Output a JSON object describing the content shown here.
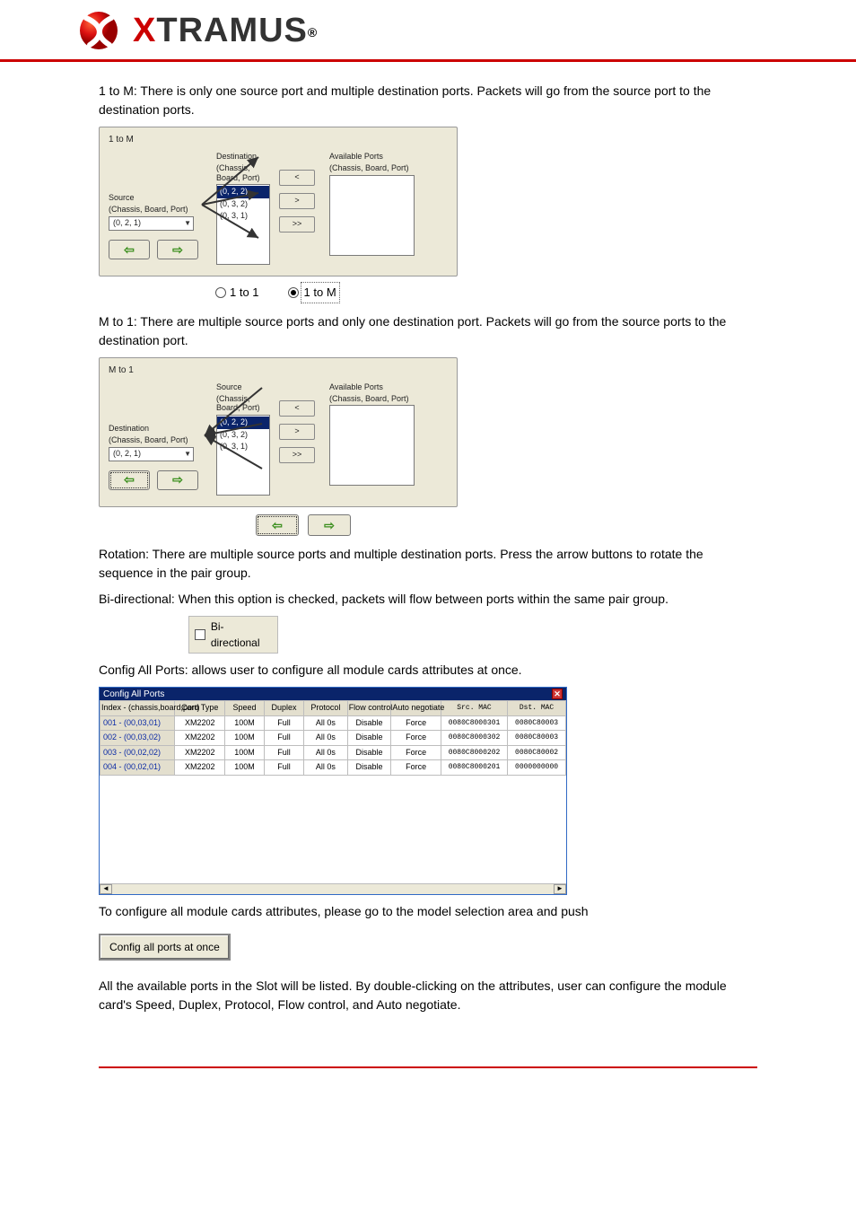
{
  "brand": {
    "x": "X",
    "rest": "TRAMUS",
    "tail": "®"
  },
  "intro_1toM": "1 to M: There is only one source port and multiple destination ports. Packets will go from the source port to the destination ports.",
  "panel_1toM": {
    "title": "1 to M",
    "left_label_top": "Source",
    "left_label_bottom": "(Chassis, Board, Port)",
    "combo_value": "(0, 2, 1)",
    "mid_label_top": "Destination",
    "mid_label_bottom": "(Chassis, Board, Port)",
    "list_items": [
      "(0, 2, 2)",
      "(0, 3, 2)",
      "(0, 3, 1)"
    ],
    "right_label_top": "Available Ports",
    "right_label_bottom": "(Chassis, Board, Port)",
    "btns": {
      "lt": "<",
      "gt": ">",
      "gtgt": ">>"
    }
  },
  "radio_strip": {
    "opt1": "1 to 1",
    "opt2": "1 to M"
  },
  "intro_Mto1": "M to 1: There are multiple source ports and only one destination port. Packets will go from the source ports to the destination port.",
  "panel_Mto1": {
    "title": "M to 1",
    "left_label_top": "Destination",
    "left_label_bottom": "(Chassis, Board, Port)",
    "combo_value": "(0, 2, 1)",
    "mid_label_top": "Source",
    "mid_label_bottom": "(Chassis, Board, Port)",
    "list_items": [
      "(0, 2, 2)",
      "(0, 3, 2)",
      "(0, 3, 1)"
    ],
    "right_label_top": "Available Ports",
    "right_label_bottom": "(Chassis, Board, Port)",
    "btns": {
      "lt": "<",
      "gt": ">",
      "gtgt": ">>"
    }
  },
  "rotation_para": "Rotation: There are multiple source ports and multiple destination ports. Press the arrow buttons to rotate the sequence in the pair group.",
  "bi_dir_para": "Bi-directional: When this option is checked, packets will flow between ports within the same pair group.",
  "bi_dir_label": "Bi-directional",
  "configall_intro": "Config All Ports: allows user to configure all module cards attributes at once.",
  "table_title": "Config All Ports",
  "table_headers": [
    "Index - (chassis,board,port)",
    "Card Type",
    "Speed",
    "Duplex",
    "Protocol",
    "Flow control",
    "Auto negotiate",
    "Src. MAC",
    "Dst. MAC"
  ],
  "table_rows": [
    {
      "idx": "001 - (00,03,01)",
      "card": "XM2202",
      "speed": "100M",
      "duplex": "Full",
      "proto": "All 0s",
      "flow": "Disable",
      "auto": "Force",
      "src": "0080C8000301",
      "dst": "0080C80003"
    },
    {
      "idx": "002 - (00,03,02)",
      "card": "XM2202",
      "speed": "100M",
      "duplex": "Full",
      "proto": "All 0s",
      "flow": "Disable",
      "auto": "Force",
      "src": "0080C8000302",
      "dst": "0080C80003"
    },
    {
      "idx": "003 - (00,02,02)",
      "card": "XM2202",
      "speed": "100M",
      "duplex": "Full",
      "proto": "All 0s",
      "flow": "Disable",
      "auto": "Force",
      "src": "0080C8000202",
      "dst": "0080C80002"
    },
    {
      "idx": "004 - (00,02,01)",
      "card": "XM2202",
      "speed": "100M",
      "duplex": "Full",
      "proto": "All 0s",
      "flow": "Disable",
      "auto": "Force",
      "src": "0080C8000201",
      "dst": "0000000000"
    }
  ],
  "configall_hint_1": "To configure all module cards attributes, please go to the model selection area and push",
  "configall_btn": "Config all ports at once",
  "configall_hint_2": "All the available ports in the Slot will be listed. By double-clicking on the attributes, user can configure the module card's Speed, Duplex, Protocol, Flow control, and Auto negotiate."
}
